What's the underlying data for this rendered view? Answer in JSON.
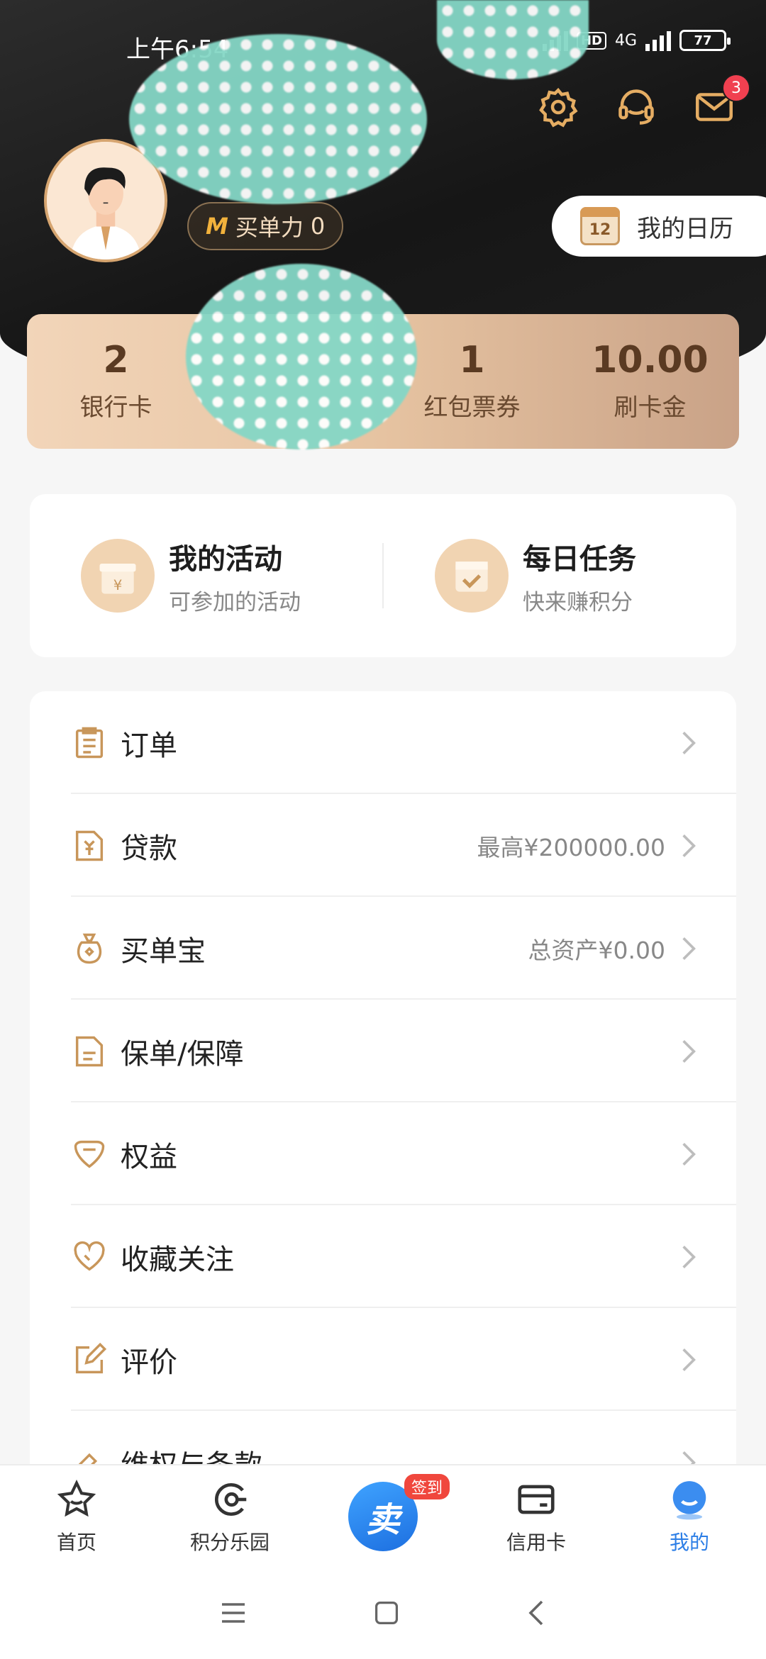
{
  "status_bar": {
    "time": "上午6:54",
    "net_hd": "HD",
    "net_gen": "4G",
    "battery": "77"
  },
  "header": {
    "mail_badge": "3",
    "buy_power": {
      "prefix": "M",
      "label": "买单力",
      "value": "0"
    },
    "calendar": {
      "day": "12",
      "label": "我的日历"
    }
  },
  "stats": [
    {
      "value": "2",
      "label": "银行卡"
    },
    {
      "value": "",
      "label": ""
    },
    {
      "value": "1",
      "label": "红包票券"
    },
    {
      "value": "10.00",
      "label": "刷卡金"
    }
  ],
  "activities": [
    {
      "title": "我的活动",
      "subtitle": "可参加的活动",
      "icon_text": "¥"
    },
    {
      "title": "每日任务",
      "subtitle": "快来赚积分"
    }
  ],
  "menu": [
    {
      "label": "订单",
      "extra": "",
      "icon": "clipboard-icon"
    },
    {
      "label": "贷款",
      "extra": "最高¥200000.00",
      "icon": "loan-doc-icon"
    },
    {
      "label": "买单宝",
      "extra": "总资产¥0.00",
      "icon": "money-bag-icon"
    },
    {
      "label": "保单/保障",
      "extra": "",
      "icon": "policy-doc-icon"
    },
    {
      "label": "权益",
      "extra": "",
      "icon": "diamond-icon"
    },
    {
      "label": "收藏关注",
      "extra": "",
      "icon": "heart-icon"
    },
    {
      "label": "评价",
      "extra": "",
      "icon": "edit-icon"
    },
    {
      "label": "维权与条款",
      "extra": "",
      "icon": "gavel-icon"
    }
  ],
  "nav": [
    {
      "label": "首页",
      "icon": "star-icon"
    },
    {
      "label": "积分乐园",
      "icon": "points-icon"
    },
    {
      "label": "",
      "icon": "sign-in-icon",
      "tag": "签到",
      "glyph": "卖"
    },
    {
      "label": "信用卡",
      "icon": "card-icon"
    },
    {
      "label": "我的",
      "icon": "profile-icon"
    }
  ],
  "colors": {
    "accent": "#c8965a",
    "nav_active": "#2c7ee6",
    "badge": "#f04050"
  }
}
